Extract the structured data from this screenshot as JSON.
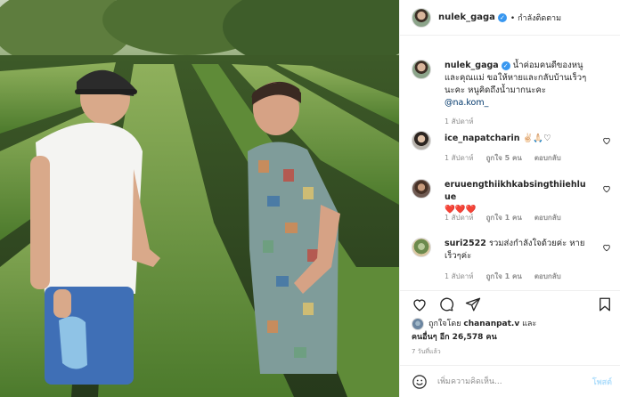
{
  "post": {
    "username": "nulek_gaga",
    "follow_label": "• กำลังติดตาม",
    "caption_text": "น้ำค่อมคนดีของหนูและคุณแม่ ขอให้หายและกลับบ้านเร็วๆนะคะ หนูคิดถึงน้ำมากนะคะ",
    "caption_mention": "@na.kom_",
    "caption_time": "1 สัปดาห์"
  },
  "comments": [
    {
      "username": "ice_napatcharin",
      "text": "✌🏻🙏🏻♡",
      "time": "1 สัปดาห์",
      "likes": "ถูกใจ 5 คน",
      "reply": "ตอบกลับ"
    },
    {
      "username": "eruuengthiikhkabsingthiiehluue",
      "text": "❤️❤️❤️",
      "time": "1 สัปดาห์",
      "likes": "ถูกใจ 1 คน",
      "reply": "ตอบกลับ"
    },
    {
      "username": "suri2522",
      "text": "รวมส่งกำลังใจด้วยค่ะ หายเร็วๆค่ะ",
      "time": "1 สัปดาห์",
      "likes": "ถูกใจ 1 คน",
      "reply": "ตอบกลับ"
    }
  ],
  "likes": {
    "prefix": "ถูกใจโดย",
    "by": "chananpat.v",
    "and": "และ",
    "others": "คนอื่นๆ อีก 26,578 คน"
  },
  "time_ago": "7 วันที่แล้ว",
  "add_comment": {
    "placeholder": "เพิ่มความคิดเห็น...",
    "post_label": "โพสต์"
  },
  "icons": {
    "verified": "verified-badge-icon",
    "like": "heart-icon",
    "comment": "comment-icon",
    "share": "share-icon",
    "save": "bookmark-icon",
    "emoji": "emoji-icon"
  },
  "colors": {
    "link": "#00376b",
    "verified": "#3897f0",
    "post_btn_disabled": "#b2dffc",
    "muted": "#8e8e8e"
  }
}
